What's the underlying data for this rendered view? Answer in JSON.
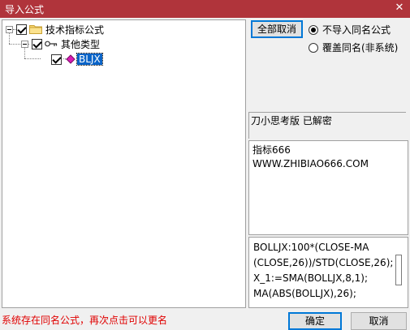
{
  "window": {
    "title": "导入公式",
    "close_glyph": "✕"
  },
  "tree": {
    "root_label": "技术指标公式",
    "child_label": "其他类型",
    "leaf_label": "BLJX"
  },
  "toolbar": {
    "clear_all_label": "全部取消"
  },
  "options": {
    "no_import_label": "不导入同名公式",
    "overwrite_label": "覆盖同名(非系统)"
  },
  "status_text": "刀小思考版 已解密",
  "info_lines": [
    "指标666",
    "WWW.ZHIBIAO666.COM"
  ],
  "formula_lines": [
    "BOLLJX:100*(CLOSE-MA",
    "(CLOSE,26))/STD(CLOSE,26);",
    "X_1:=SMA(BOLLJX,8,1);",
    "MA(ABS(BOLLJX),26);"
  ],
  "message": "系统存在同名公式，再次点击可以更名",
  "buttons": {
    "ok_label": "确定",
    "cancel_label": "取消"
  },
  "colors": {
    "titlebar": "#b0343b",
    "selection": "#0a64c8",
    "message": "#e00000"
  }
}
